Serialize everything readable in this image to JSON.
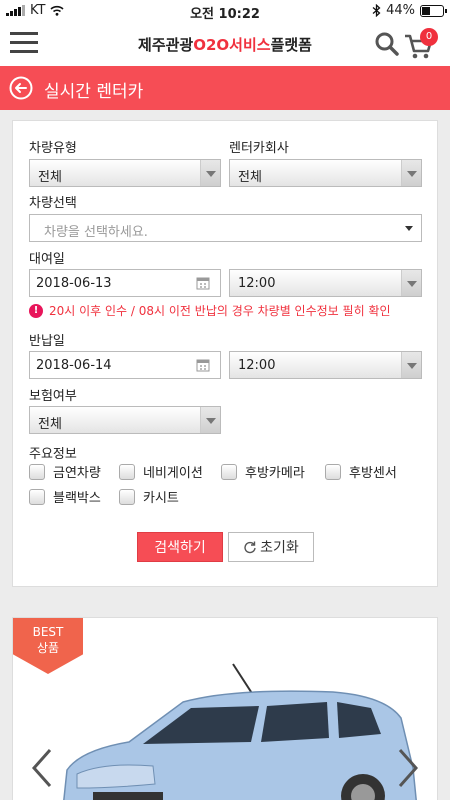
{
  "status_bar": {
    "carrier": "KT",
    "time": "오전 10:22",
    "battery": "44%",
    "battery_level": 0.44
  },
  "header": {
    "logo_prefix": "제주관광",
    "logo_highlight": "O2O서비스",
    "logo_suffix": "플랫폼",
    "cart_count": "0"
  },
  "page": {
    "title": "실시간 렌터카"
  },
  "form": {
    "car_type": {
      "label": "차량유형",
      "value": "전체"
    },
    "rental_company": {
      "label": "렌터카회사",
      "value": "전체"
    },
    "car_select": {
      "label": "차량선택",
      "placeholder": "차량을 선택하세요."
    },
    "rental_date": {
      "label": "대여일",
      "value": "2018-06-13",
      "time": "12:00"
    },
    "warning": "20시 이후 인수 / 08시 이전 반납의 경우 차량별 인수정보 필히 확인",
    "return_date": {
      "label": "반납일",
      "value": "2018-06-14",
      "time": "12:00"
    },
    "insurance": {
      "label": "보험여부",
      "value": "전체"
    },
    "features": {
      "label": "주요정보",
      "options": [
        "금연차량",
        "네비게이션",
        "후방카메라",
        "후방센서",
        "블랙박스",
        "카시트"
      ]
    },
    "search_label": "검색하기",
    "reset_label": "초기화"
  },
  "best": {
    "badge_line1": "BEST",
    "badge_line2": "상품"
  },
  "colors": {
    "accent": "#f64d55",
    "warning": "#f0313e"
  }
}
